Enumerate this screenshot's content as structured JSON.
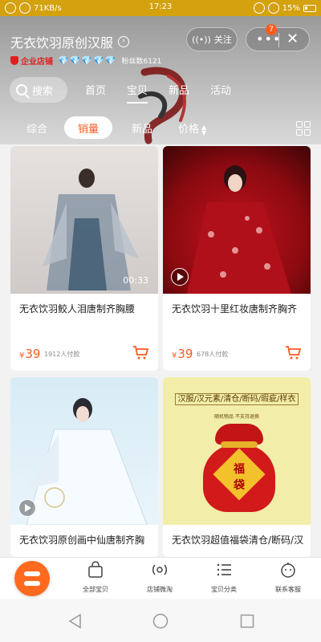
{
  "status_bar": {
    "speed": "71KB/s",
    "time": "17:23",
    "battery": "15%"
  },
  "shop": {
    "name": "无衣饮羽原创汉服",
    "enterprise_label": "企业店铺",
    "diamonds": "💎💎💎💎💎",
    "fans": "粉丝数6121",
    "follow_label": "关注",
    "notification_count": "7"
  },
  "search": {
    "label": "搜索"
  },
  "nav_tabs": [
    "首页",
    "宝贝",
    "新品",
    "活动"
  ],
  "active_nav_tab": "宝贝",
  "sort_tabs": {
    "comprehensive": "综合",
    "sales": "销量",
    "new": "新品",
    "price": "价格"
  },
  "products": [
    {
      "title": "无衣饮羽鲛人泪唐制齐胸腰",
      "currency": "¥",
      "price": "39",
      "paid": "1912人付款",
      "video_duration": "00:33"
    },
    {
      "title": "无衣饮羽十里红妆唐制齐胸齐",
      "currency": "¥",
      "price": "39",
      "paid": "678人付款"
    },
    {
      "title": "无衣饮羽原创画中仙唐制齐胸"
    },
    {
      "title": "无衣饮羽超值福袋清仓/断码/汉",
      "tags": "汉服/汉元素/清仓/断码/瑕疵/样衣",
      "sub": "随机物品    不支持退换",
      "bag_char1": "福",
      "bag_char2": "袋"
    }
  ],
  "tab_bar": {
    "all_items": "全部宝贝",
    "live": "店铺微淘",
    "categories": "宝贝分类",
    "service": "联系客服"
  },
  "colors": {
    "accent": "#ff5a1f",
    "status_bar": "#d4a10f"
  }
}
